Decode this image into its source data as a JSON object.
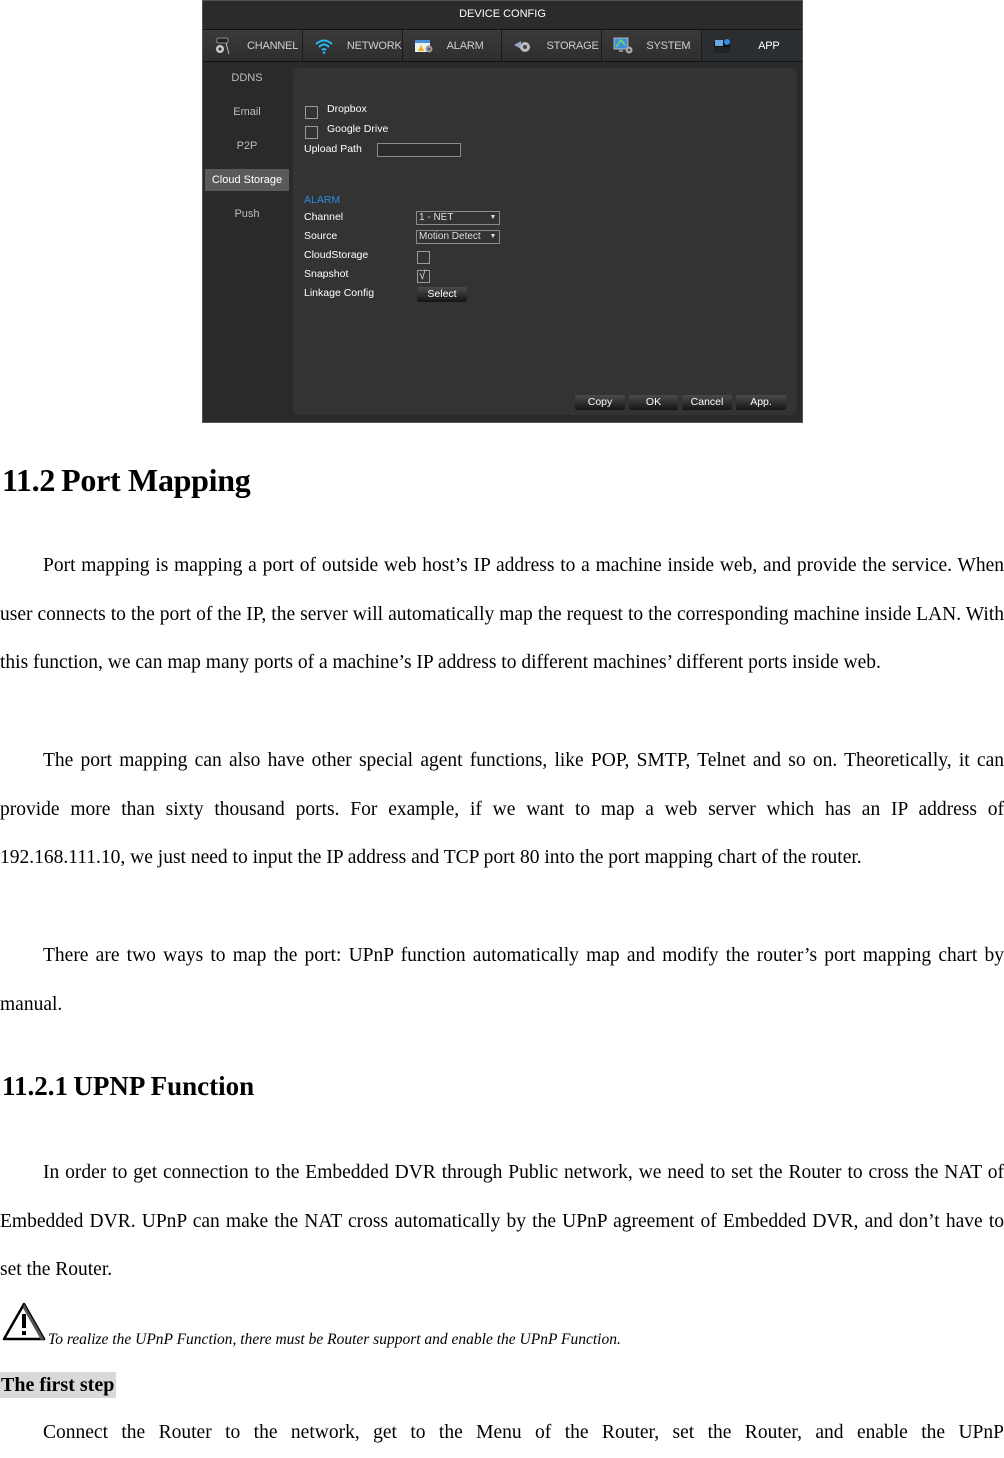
{
  "dvr": {
    "title": "DEVICE CONFIG",
    "tabs": [
      {
        "label": "CHANNEL",
        "icon": "camera-gear-icon"
      },
      {
        "label": "NETWORK",
        "icon": "wifi-icon"
      },
      {
        "label": "ALARM",
        "icon": "alarm-calendar-icon"
      },
      {
        "label": "STORAGE",
        "icon": "storage-gear-icon"
      },
      {
        "label": "SYSTEM",
        "icon": "monitor-gear-icon"
      },
      {
        "label": "APP",
        "icon": "app-folder-icon",
        "active": true
      }
    ],
    "sidebar": [
      {
        "label": "DDNS"
      },
      {
        "label": "Email"
      },
      {
        "label": "P2P"
      },
      {
        "label": "Cloud Storage",
        "active": true
      },
      {
        "label": "Push"
      }
    ],
    "cloud": {
      "dropbox_label": "Dropbox",
      "dropbox_checked": false,
      "gdrive_label": "Google Drive",
      "gdrive_checked": false,
      "upload_path_label": "Upload Path",
      "upload_path_value": ""
    },
    "alarm": {
      "section_title": "ALARM",
      "channel_label": "Channel",
      "channel_value": "1 - NET",
      "source_label": "Source",
      "source_value": "Motion Detect",
      "cloudstorage_label": "CloudStorage",
      "cloudstorage_checked": false,
      "snapshot_label": "Snapshot",
      "snapshot_checked": true,
      "linkage_label": "Linkage Config",
      "select_button": "Select"
    },
    "buttons": {
      "copy": "Copy",
      "ok": "OK",
      "cancel": "Cancel",
      "apply": "App."
    },
    "accent_color": "#2e8be0"
  },
  "doc": {
    "section_heading": "11.2 Port Mapping",
    "p1": "Port mapping is mapping a port of outside web host’s IP address to a machine inside web, and provide the service. When user connects to the port of the IP, the server will automatically map the request to the corresponding machine inside LAN. With this function, we can map many ports of a machine’s IP address to different machines’ different ports inside web.",
    "p2": "The port mapping can also have other special agent functions, like POP, SMTP, Telnet and so on. Theoretically, it can provide more than sixty thousand ports. For example, if we want to map a web server which has an IP address of 192.168.111.10, we just need to input the IP address and TCP port 80 into the port mapping chart of the router.",
    "p3": "There are two ways to map the port: UPnP function automatically map and modify the router’s port mapping chart by manual.",
    "subsection_heading": "11.2.1 UPNP Function",
    "p4": "In order to get connection to the Embedded DVR through Public network, we need to set the Router to cross the NAT of Embedded DVR. UPnP can make the NAT cross automatically by the UPnP agreement of Embedded DVR, and don’t have to set the Router.",
    "note": "To realize the UPnP Function, there must be Router support and enable the UPnP Function.",
    "step_heading": "The first step",
    "p5": "Connect the Router to the network, get to the Menu of the Router, set the Router, and enable the UPnP"
  }
}
